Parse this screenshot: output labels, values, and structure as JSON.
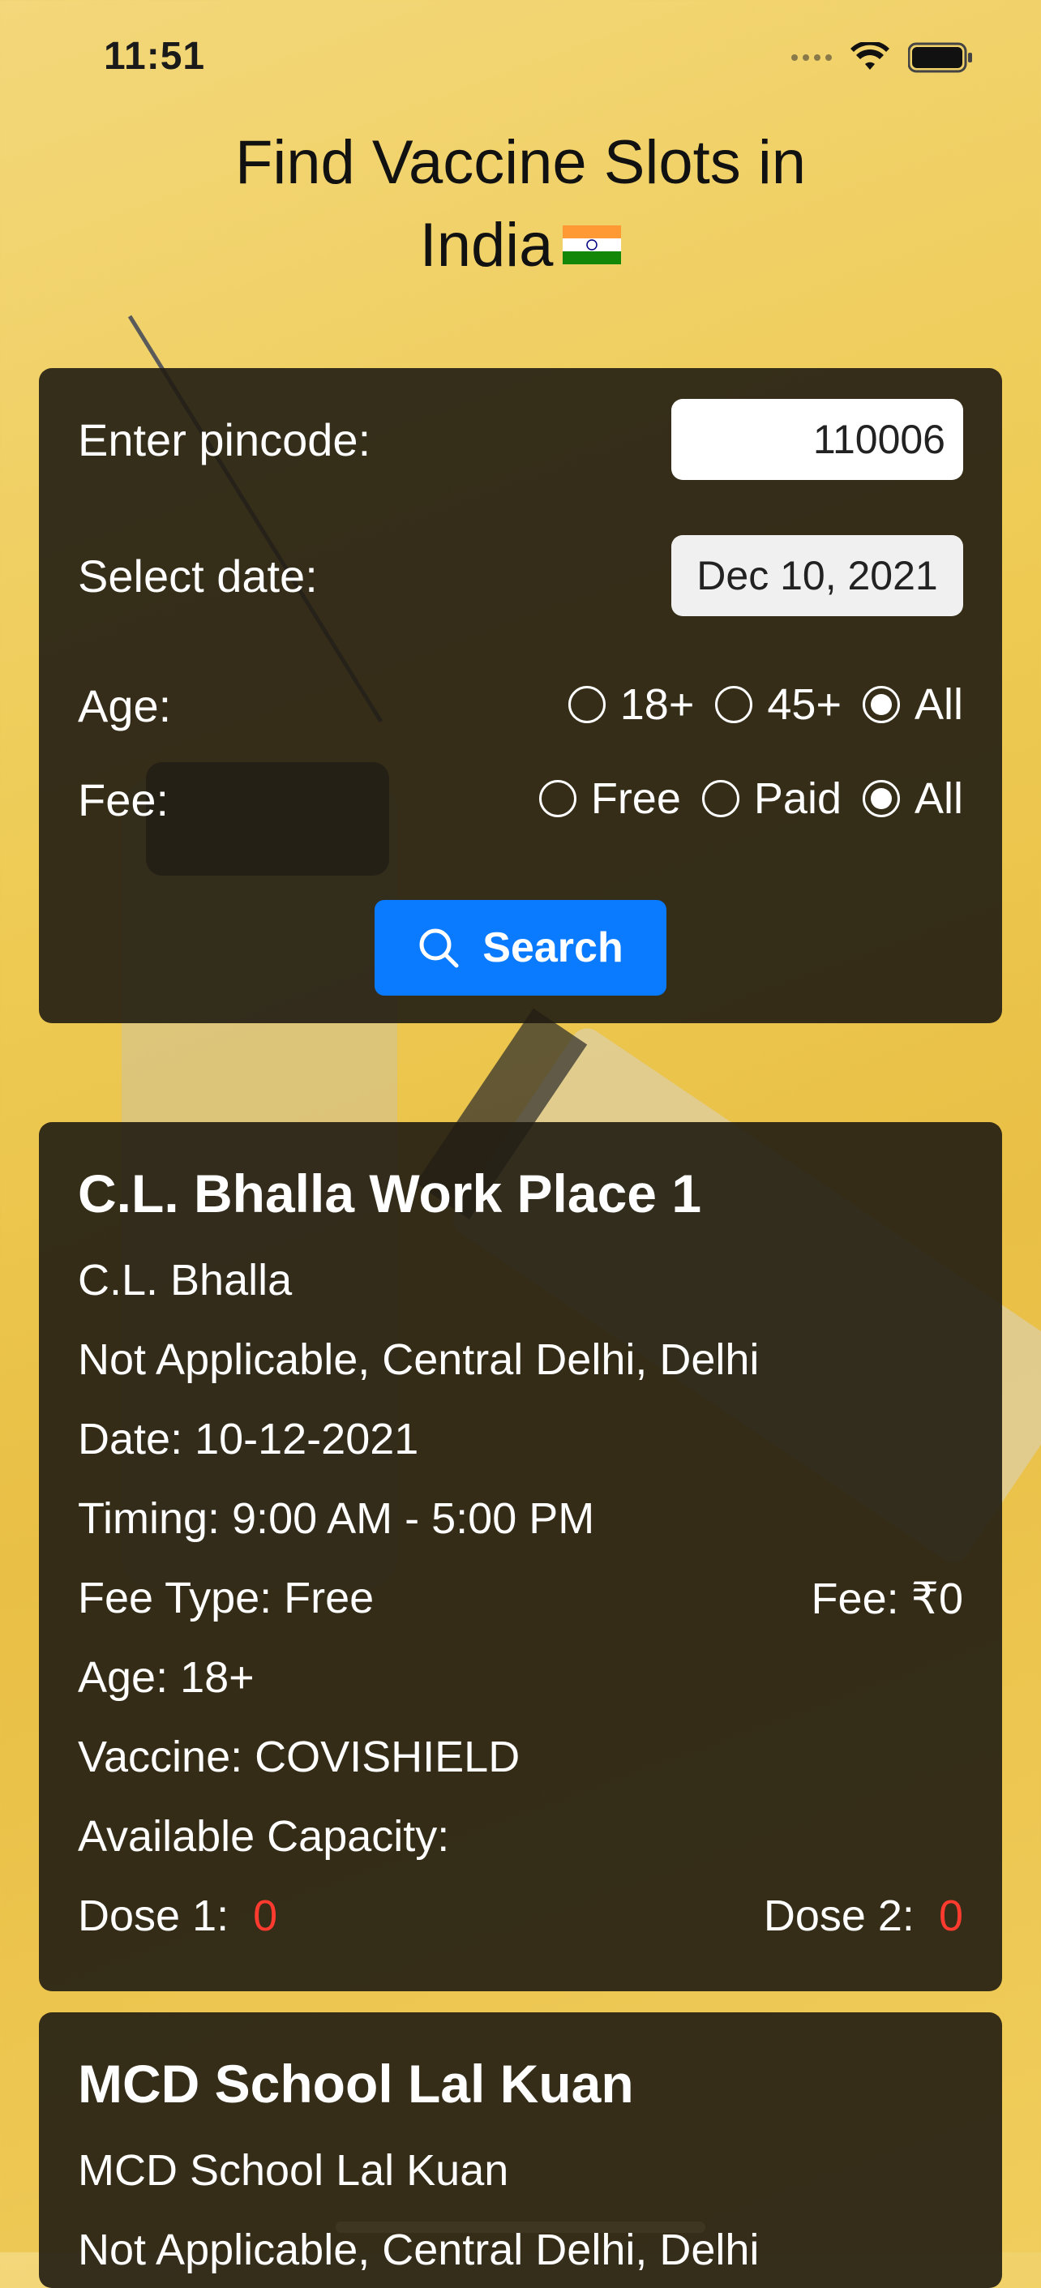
{
  "status": {
    "time": "11:51"
  },
  "title": {
    "line1": "Find Vaccine Slots in",
    "line2": "India"
  },
  "form": {
    "pincode_label": "Enter pincode:",
    "pincode_value": "110006",
    "date_label": "Select date:",
    "date_value": "Dec 10, 2021",
    "age_label": "Age:",
    "age_options": [
      "18+",
      "45+",
      "All"
    ],
    "age_selected": "All",
    "fee_label": "Fee:",
    "fee_options": [
      "Free",
      "Paid",
      "All"
    ],
    "fee_selected": "All",
    "search_label": "Search"
  },
  "results": [
    {
      "name": "C.L. Bhalla Work Place 1",
      "org": "C.L. Bhalla",
      "address": "Not Applicable, Central Delhi, Delhi",
      "date": "Date: 10-12-2021",
      "timing": "Timing: 9:00 AM - 5:00 PM",
      "fee_type": "Fee Type: Free",
      "fee": "Fee: ₹0",
      "age": "Age: 18+",
      "vaccine": "Vaccine: COVISHIELD",
      "capacity_label": "Available Capacity:",
      "dose1_label": "Dose 1:",
      "dose1_value": "0",
      "dose2_label": "Dose 2:",
      "dose2_value": "0"
    },
    {
      "name": "MCD School Lal Kuan",
      "org": "MCD School Lal Kuan",
      "address": "Not Applicable, Central Delhi, Delhi"
    }
  ],
  "colors": {
    "accent": "#0a7aff",
    "zero": "#ff3b30",
    "card": "#201c12"
  },
  "icons": [
    "search-icon",
    "wifi-icon",
    "battery-icon",
    "signal-icon",
    "india-flag-icon"
  ]
}
